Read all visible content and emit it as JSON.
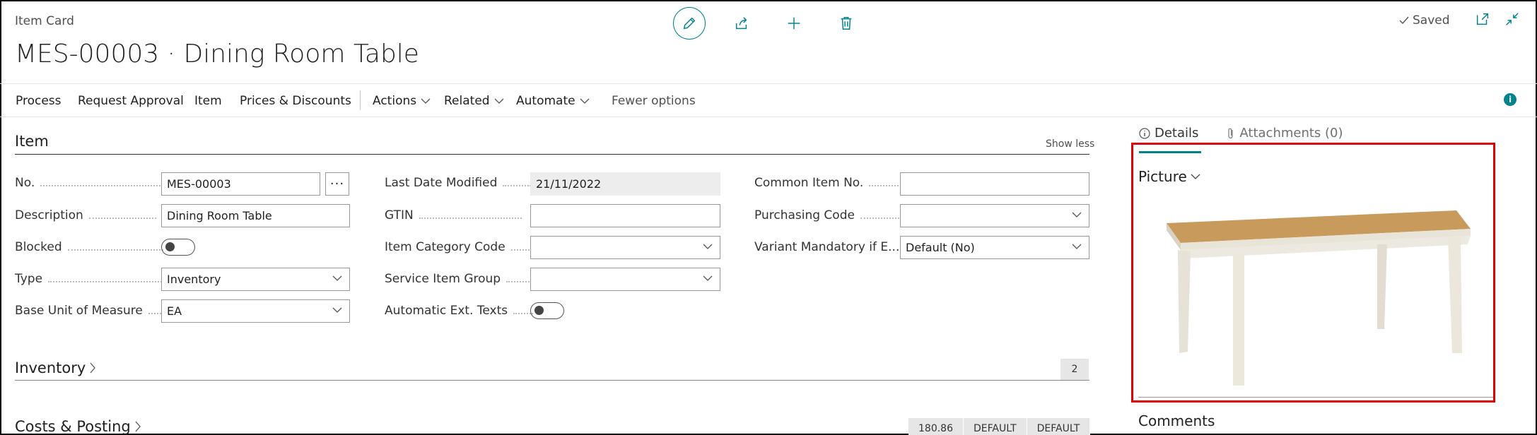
{
  "header": {
    "breadcrumb": "Item Card",
    "title": "MES-00003 · Dining Room Table",
    "saved_label": "Saved"
  },
  "actionbar": {
    "items": [
      "Process",
      "Request Approval",
      "Item",
      "Prices & Discounts"
    ],
    "menus": [
      "Actions",
      "Related",
      "Automate"
    ],
    "fewer_options": "Fewer options"
  },
  "item_section": {
    "title": "Item",
    "show_less": "Show less",
    "fields": {
      "no": {
        "label": "No.",
        "value": "MES-00003"
      },
      "description": {
        "label": "Description",
        "value": "Dining Room Table"
      },
      "blocked": {
        "label": "Blocked",
        "on": false
      },
      "type": {
        "label": "Type",
        "value": "Inventory"
      },
      "base_uom": {
        "label": "Base Unit of Measure",
        "value": "EA"
      },
      "last_modified": {
        "label": "Last Date Modified",
        "value": "21/11/2022"
      },
      "gtin": {
        "label": "GTIN",
        "value": ""
      },
      "item_category": {
        "label": "Item Category Code",
        "value": ""
      },
      "service_group": {
        "label": "Service Item Group",
        "value": ""
      },
      "auto_ext_texts": {
        "label": "Automatic Ext. Texts",
        "on": false
      },
      "common_item_no": {
        "label": "Common Item No.",
        "value": ""
      },
      "purchasing_code": {
        "label": "Purchasing Code",
        "value": ""
      },
      "variant_mandatory": {
        "label": "Variant Mandatory if E...",
        "value": "Default (No)"
      }
    }
  },
  "inventory_section": {
    "title": "Inventory",
    "badge": "2"
  },
  "costs_section": {
    "title": "Costs & Posting",
    "badges": [
      "180.86",
      "DEFAULT",
      "DEFAULT"
    ]
  },
  "factbox": {
    "tabs": [
      "Details",
      "Attachments (0)"
    ],
    "picture_heading": "Picture",
    "comments_heading": "Comments"
  },
  "colors": {
    "accent": "#00838f",
    "highlight": "#e00000"
  }
}
